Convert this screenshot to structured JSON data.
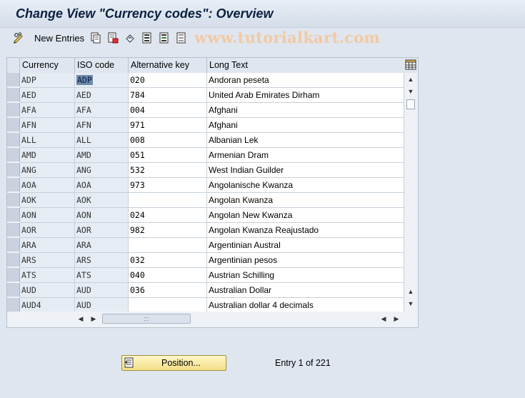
{
  "window": {
    "title": "Change View \"Currency codes\": Overview"
  },
  "toolbar": {
    "new_entries_label": "New Entries",
    "icons": [
      "glasses-edit-icon",
      "copy-icon",
      "delete-icon",
      "undo-change-icon",
      "select-all-icon",
      "select-block-icon",
      "deselect-all-icon"
    ],
    "watermark": "www.tutorialkart.com"
  },
  "table": {
    "columns": [
      "Currency",
      "ISO code",
      "Alternative key",
      "Long Text"
    ],
    "rows": [
      {
        "currency": "ADP",
        "iso": "ADP",
        "alt": "020",
        "text": "Andoran peseta"
      },
      {
        "currency": "AED",
        "iso": "AED",
        "alt": "784",
        "text": "United Arab Emirates Dirham"
      },
      {
        "currency": "AFA",
        "iso": "AFA",
        "alt": "004",
        "text": "Afghani"
      },
      {
        "currency": "AFN",
        "iso": "AFN",
        "alt": "971",
        "text": "Afghani"
      },
      {
        "currency": "ALL",
        "iso": "ALL",
        "alt": "008",
        "text": "Albanian Lek"
      },
      {
        "currency": "AMD",
        "iso": "AMD",
        "alt": "051",
        "text": "Armenian Dram"
      },
      {
        "currency": "ANG",
        "iso": "ANG",
        "alt": "532",
        "text": "West Indian Guilder"
      },
      {
        "currency": "AOA",
        "iso": "AOA",
        "alt": "973",
        "text": "Angolanische Kwanza"
      },
      {
        "currency": "AOK",
        "iso": "AOK",
        "alt": "",
        "text": "Angolan Kwanza"
      },
      {
        "currency": "AON",
        "iso": "AON",
        "alt": "024",
        "text": "Angolan New Kwanza"
      },
      {
        "currency": "AOR",
        "iso": "AOR",
        "alt": "982",
        "text": "Angolan Kwanza Reajustado"
      },
      {
        "currency": "ARA",
        "iso": "ARA",
        "alt": "",
        "text": "Argentinian Austral"
      },
      {
        "currency": "ARS",
        "iso": "ARS",
        "alt": "032",
        "text": "Argentinian pesos"
      },
      {
        "currency": "ATS",
        "iso": "ATS",
        "alt": "040",
        "text": "Austrian Schilling"
      },
      {
        "currency": "AUD",
        "iso": "AUD",
        "alt": "036",
        "text": "Australian Dollar"
      },
      {
        "currency": "AUD4",
        "iso": "AUD",
        "alt": "",
        "text": "Australian dollar 4 decimals"
      }
    ]
  },
  "footer": {
    "position_label": "Position...",
    "entry_text": "Entry 1 of 221"
  },
  "colors": {
    "accent": "#f3df86",
    "highlight": "#6e89ad",
    "title": "#0b2140"
  }
}
